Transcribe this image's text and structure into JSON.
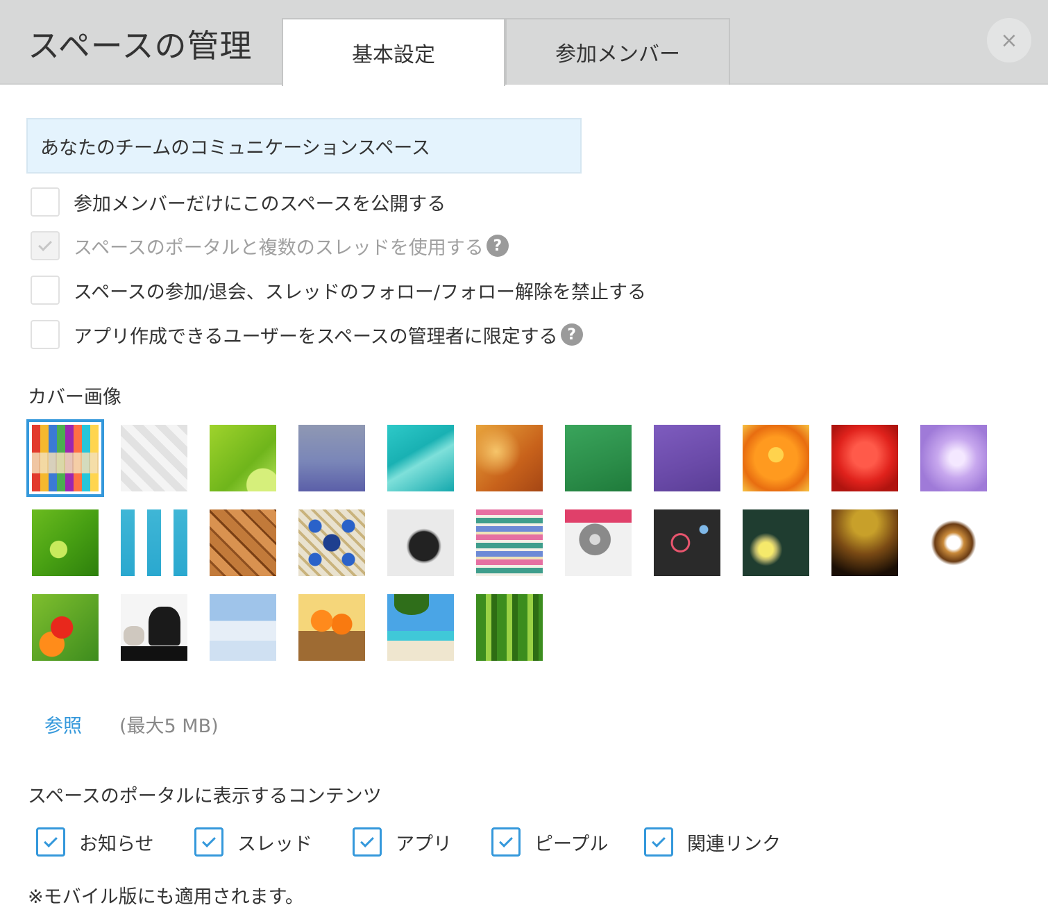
{
  "header": {
    "title": "スペースの管理",
    "tabs": [
      "基本設定",
      "参加メンバー"
    ],
    "close_label": "×"
  },
  "space_name": {
    "value": "あなたのチームのコミュニケーションスペース"
  },
  "options": [
    {
      "label": "参加メンバーだけにこのスペースを公開する",
      "checked": false,
      "disabled": false
    },
    {
      "label": "スペースのポータルと複数のスレッドを使用する",
      "checked": true,
      "disabled": true,
      "help": "?"
    },
    {
      "label": "スペースの参加/退会、スレッドのフォロー/フォロー解除を禁止する",
      "checked": false,
      "disabled": false
    },
    {
      "label": "アプリ作成できるユーザーをスペースの管理者に限定する",
      "checked": false,
      "disabled": false,
      "help": "?"
    }
  ],
  "cover": {
    "label": "カバー画像",
    "selected_index": 0,
    "browse_label": "参照",
    "max_size": "(最大5 MB)"
  },
  "portal": {
    "label": "スペースのポータルに表示するコンテンツ",
    "items": [
      {
        "label": "お知らせ",
        "checked": true
      },
      {
        "label": "スレッド",
        "checked": true
      },
      {
        "label": "アプリ",
        "checked": true
      },
      {
        "label": "ピープル",
        "checked": true
      },
      {
        "label": "関連リンク",
        "checked": true
      }
    ],
    "note": "※モバイル版にも適用されます。"
  },
  "colors": {
    "accent": "#3498db",
    "header_bg": "#d7d8d8",
    "input_bg": "#e4f3fd"
  }
}
